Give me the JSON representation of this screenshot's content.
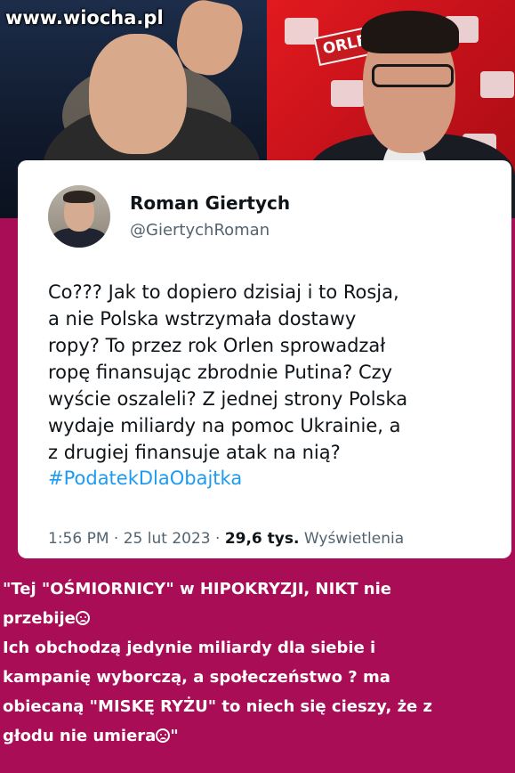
{
  "watermark": "www.wiocha.pl",
  "photo": {
    "banner_text": "ORLEN"
  },
  "tweet": {
    "name": "Roman Giertych",
    "handle": "@GiertychRoman",
    "text": "Co??? Jak to dopiero dzisiaj i to Rosja,\na nie Polska wstrzymała dostawy\nropy? To przez rok Orlen sprowadzał\nropę finansując zbrodnie Putina? Czy\nwyście oszaleli? Z jednej strony Polska\nwydaje miliardy na pomoc Ukrainie, a\nz drugiej finansuje atak na nią?",
    "hashtag": "#PodatekDlaObajtka",
    "time": "1:56 PM",
    "separator": "·",
    "date": "25 lut 2023",
    "views_count": "29,6 tys.",
    "views_label": "Wyświetlenia"
  },
  "caption": {
    "line1": "\"Tej \"OŚMIORNICY\" w HIPOKRYZJI, NIKT nie",
    "line2": "przebije",
    "line3": "Ich obchodzą jedynie miliardy dla siebie i",
    "line4a": "kampanię wyborczą, a społeczeństwo",
    "line4b": " ma",
    "qmark": "?",
    "line5": "obiecaną \"MISKĘ RYŻU\" to niech się cieszy, że z",
    "line6a": "głodu nie umiera",
    "line6b": "\""
  },
  "colors": {
    "background": "#a80d55",
    "hashtag": "#1d9bf0",
    "muted": "#536471"
  },
  "icons": {
    "emoji": "sad-face-icon"
  }
}
